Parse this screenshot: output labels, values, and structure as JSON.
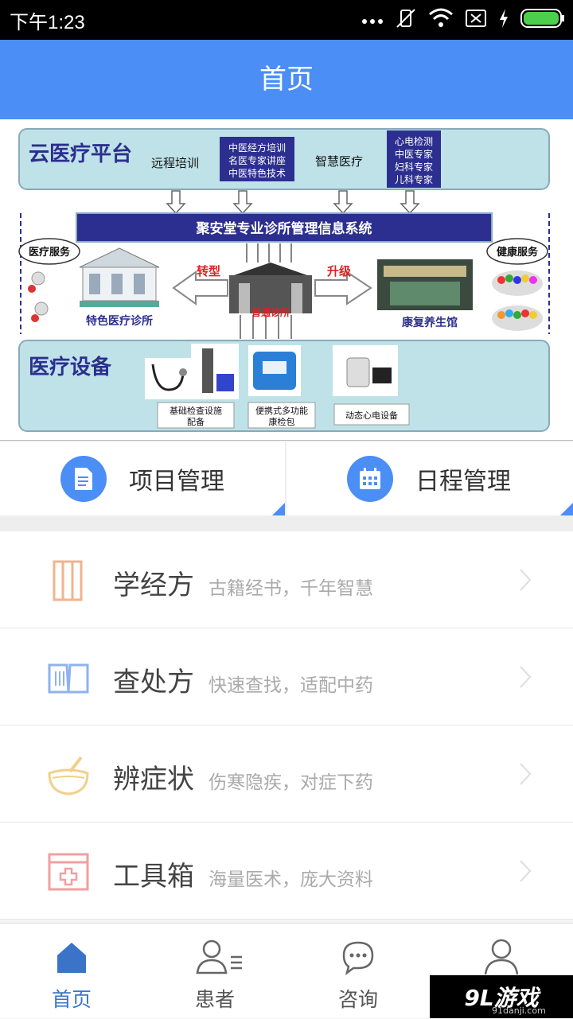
{
  "status_bar": {
    "time": "下午1:23"
  },
  "app_bar": {
    "title": "首页"
  },
  "banner": {
    "platform_title": "云医疗平台",
    "remote_training": "远程培训",
    "training_items": [
      "中医经方培训",
      "名医专家讲座",
      "中医特色技术"
    ],
    "smart_medical": "智慧医疗",
    "expert_items": [
      "心电检测",
      "中医专家",
      "妇科专家",
      "儿科专家"
    ],
    "system_name": "聚安堂专业诊所管理信息系统",
    "medical_service": "医疗服务",
    "health_service": "健康服务",
    "transform": "转型",
    "upgrade": "升级",
    "clinic_special": "特色医疗诊所",
    "clinic_normal": "普通诊所",
    "rehab": "康复养生馆",
    "equipment_title": "医疗设备",
    "device_basic": [
      "基础检查设施",
      "配备"
    ],
    "device_portable": [
      "便携式多功能",
      "康检包"
    ],
    "device_ecg": "动态心电设备",
    "slides": 3,
    "active_slide": 2
  },
  "quick_actions": [
    {
      "label": "项目管理",
      "icon": "document-icon"
    },
    {
      "label": "日程管理",
      "icon": "calendar-icon"
    }
  ],
  "menu": [
    {
      "title": "学经方",
      "subtitle": "古籍经书，千年智慧",
      "icon": "book-scroll-icon",
      "color": "#f0b48c"
    },
    {
      "title": "查处方",
      "subtitle": "快速查找，适配中药",
      "icon": "open-book-icon",
      "color": "#8fb2ef"
    },
    {
      "title": "辨症状",
      "subtitle": "伤寒隐疾，对症下药",
      "icon": "mortar-bowl-icon",
      "color": "#f2d08a"
    },
    {
      "title": "工具箱",
      "subtitle": "海量医术，庞大资料",
      "icon": "medical-kit-icon",
      "color": "#f0a0a0"
    }
  ],
  "tabs": [
    {
      "label": "首页",
      "icon": "home-icon",
      "active": true
    },
    {
      "label": "患者",
      "icon": "patients-icon",
      "active": false
    },
    {
      "label": "咨询",
      "icon": "chat-icon",
      "active": false
    },
    {
      "label": "",
      "icon": "profile-icon",
      "active": false
    }
  ],
  "watermark": {
    "brand": "9L游戏",
    "url": "91danji.com"
  },
  "colors": {
    "primary": "#4b8ef5",
    "banner_navy": "#2c2f8f",
    "banner_teal": "#bfe2e8"
  }
}
